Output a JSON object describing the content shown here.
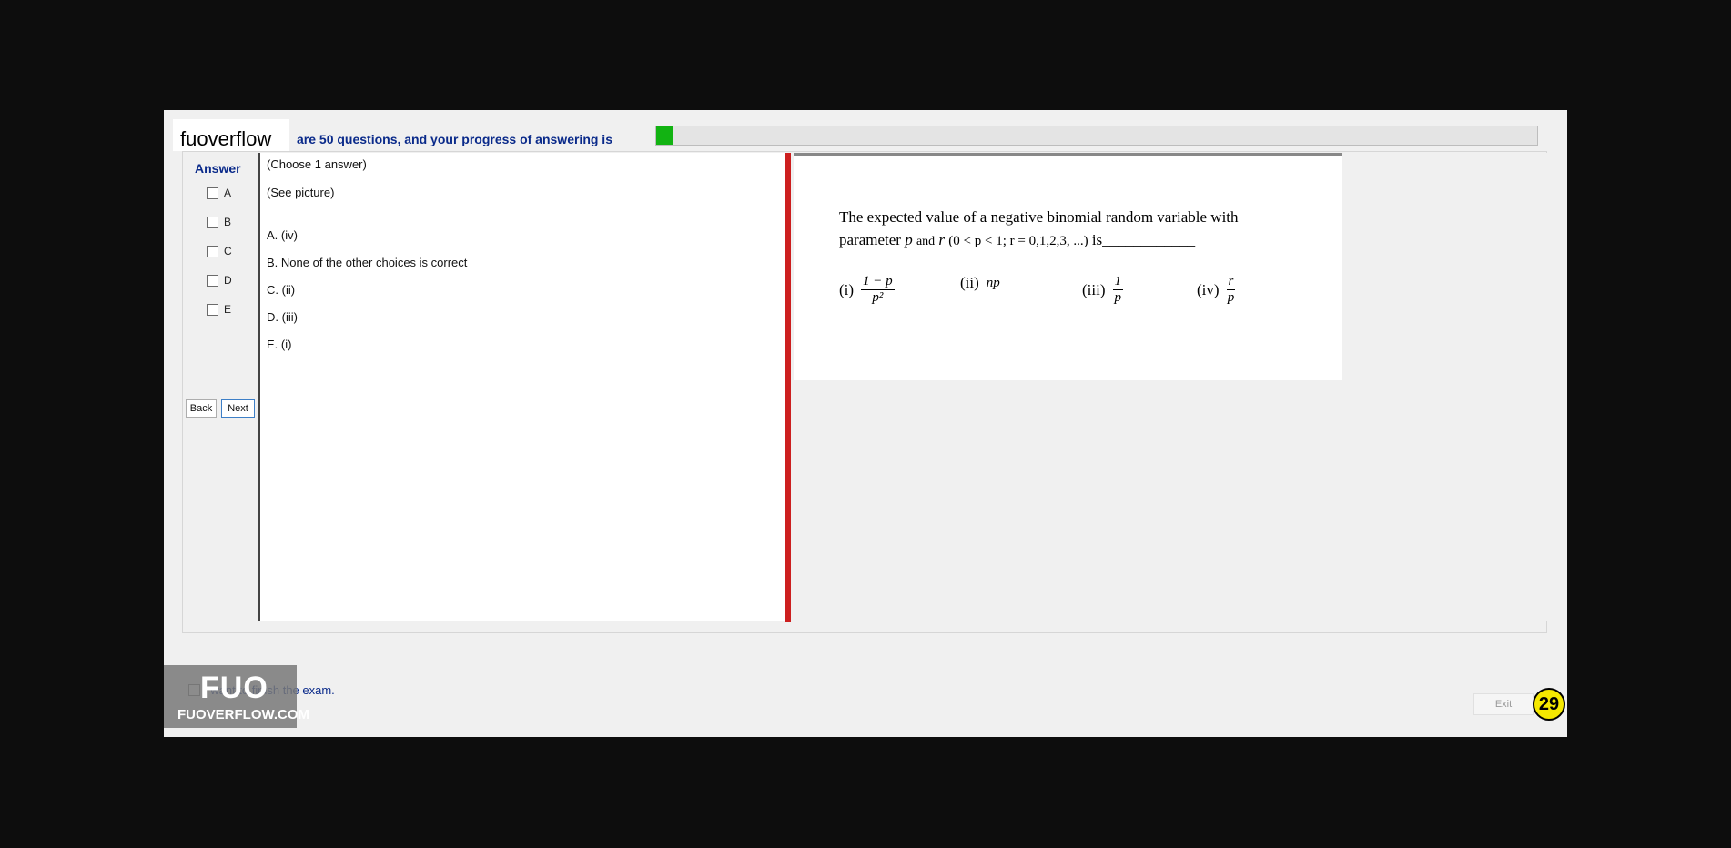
{
  "header": {
    "brand": "fuoverflow",
    "progress_text": "are 50 questions, and your progress of answering is",
    "progress_fraction": 0.02
  },
  "answer_panel": {
    "title": "Answer",
    "options": [
      "A",
      "B",
      "C",
      "D",
      "E"
    ],
    "back_label": "Back",
    "next_label": "Next"
  },
  "question_panel": {
    "instruction": "(Choose 1 answer)",
    "see_picture": "(See picture)",
    "choices": [
      "A.  (iv)",
      "B.  None of the other choices is correct",
      "C.  (ii)",
      "D.  (iii)",
      "E.  (i)"
    ]
  },
  "question_image": {
    "line1": "The expected value of a negative binomial random variable with",
    "line2_prefix": "parameter",
    "line2_p": "p",
    "line2_and": "and",
    "line2_r": "r",
    "line2_condition": "(0 < p < 1; r = 0,1,2,3, ...)",
    "line2_suffix": "is____________",
    "options": {
      "i_label": "(i)",
      "i_num": "1 − p",
      "i_den": "p²",
      "ii_label": "(ii)",
      "ii_value": "np",
      "iii_label": "(iii)",
      "iii_num": "1",
      "iii_den": "p",
      "iv_label": "(iv)",
      "iv_num": "r",
      "iv_den": "p"
    }
  },
  "footer": {
    "finish_label": "I want to finish the exam.",
    "logo_mark": "FUO",
    "logo_text": "FUOVERFLOW.COM",
    "exit_label": "Exit",
    "page_number": "29"
  },
  "colors": {
    "progress_fill": "#12b312",
    "divider": "#cc1f1f",
    "label_blue": "#0a2a8a",
    "badge": "#f5e800"
  }
}
